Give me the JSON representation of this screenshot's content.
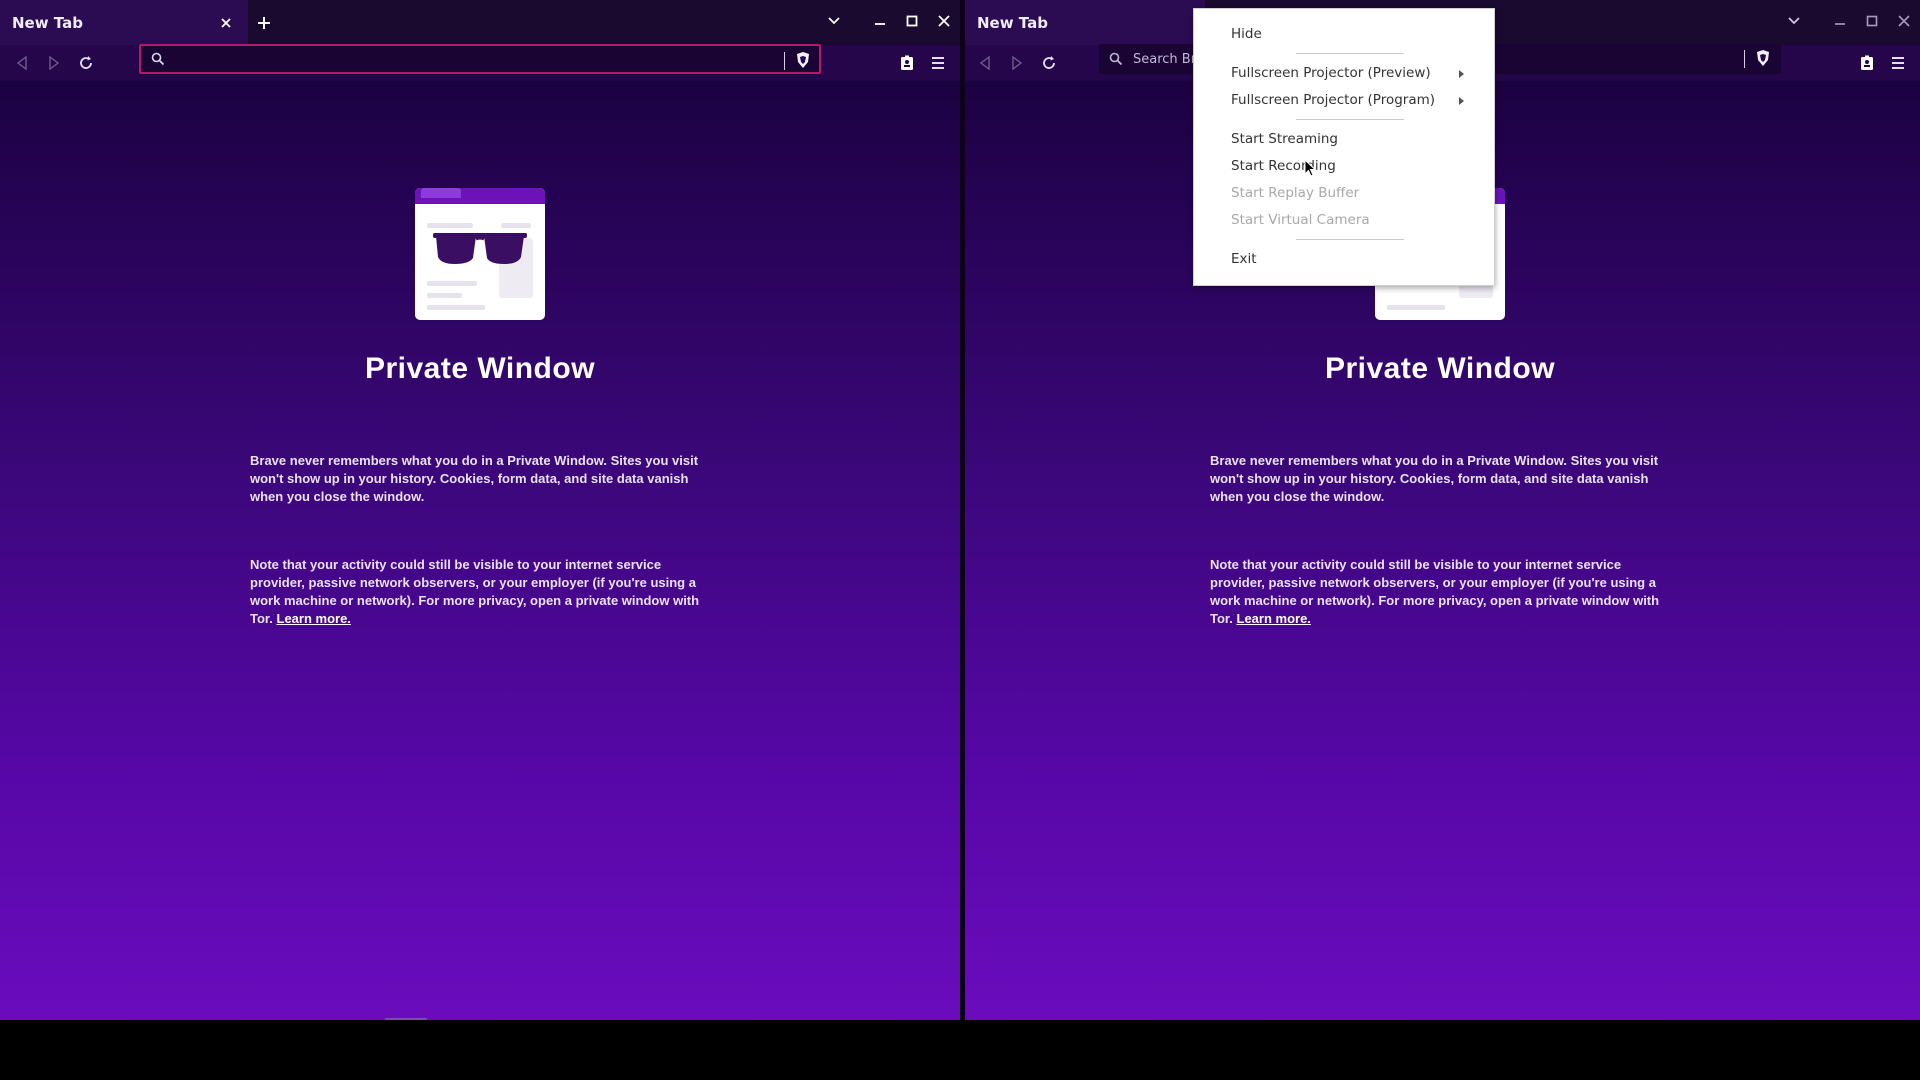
{
  "left": {
    "tab_title": "New Tab",
    "search_placeholder": "",
    "page_title": "Private Window",
    "para1": "Brave never remembers what you do in a Private Window. Sites you visit won't show up in your history. Cookies, form data, and site data vanish when you close the window.",
    "para2": "Note that your activity could still be visible to your internet service provider, passive network observers, or your employer (if you're using a work machine or network). For more privacy, open a private window with Tor.",
    "learn_more": "Learn more."
  },
  "right": {
    "tab_title": "New Tab",
    "search_placeholder": "Search Br",
    "page_title": "Private Window",
    "para1": "Brave never remembers what you do in a Private Window. Sites you visit won't show up in your history. Cookies, form data, and site data vanish when you close the window.",
    "para2": "Note that your activity could still be visible to your internet service provider, passive network observers, or your employer (if you're using a work machine or network). For more privacy, open a private window with Tor.",
    "learn_more": "Learn more."
  },
  "context_menu": {
    "hide": "Hide",
    "projector_preview": "Fullscreen Projector (Preview)",
    "projector_program": "Fullscreen Projector (Program)",
    "start_streaming": "Start Streaming",
    "start_recording": "Start Recording",
    "start_replay_buffer": "Start Replay Buffer",
    "start_virtual_camera": "Start Virtual Camera",
    "exit": "Exit"
  },
  "colors": {
    "accent": "#6b13b8",
    "focus_border": "#b41a6a",
    "gradient_top": "#12012f",
    "gradient_bottom": "#6a0cbd"
  },
  "icons": [
    "back-icon",
    "forward-icon",
    "reload-icon",
    "search-icon",
    "brave-shield-icon",
    "wallet-icon",
    "menu-icon",
    "close-icon",
    "plus-icon",
    "chevron-down-icon",
    "minimize-icon",
    "maximize-icon",
    "incognito-glasses-icon"
  ]
}
